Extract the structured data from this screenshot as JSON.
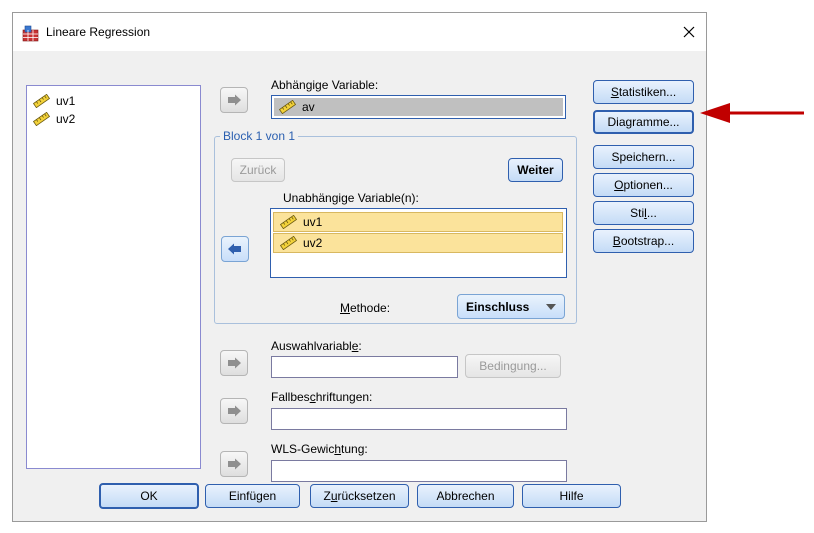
{
  "dialog": {
    "title": "Lineare Regression",
    "close_glyph": "✕"
  },
  "source_list": {
    "items": [
      {
        "label": "uv1",
        "icon": "ruler-icon"
      },
      {
        "label": "uv2",
        "icon": "ruler-icon"
      }
    ]
  },
  "dependent": {
    "label": "Abhängige Variable:",
    "value": "av"
  },
  "block": {
    "title": "Block 1 von 1",
    "back_label": "Zurück",
    "next_label": "Weiter",
    "independent_label_pre": "Unabhän",
    "independent_label_u": "g",
    "independent_label_post": "ige Variable(n):",
    "independent_items": [
      {
        "label": "uv1",
        "icon": "ruler-icon"
      },
      {
        "label": "uv2",
        "icon": "ruler-icon"
      }
    ],
    "method_label_u": "M",
    "method_label_post": "ethode:",
    "method_value": "Einschluss"
  },
  "selection": {
    "label_pre": "Auswahlvariabl",
    "label_u": "e",
    "label_post": ":",
    "condition_pre": "Bedin",
    "condition_u": "g",
    "condition_post": "ung..."
  },
  "case_labels": {
    "label_pre": "Fallbes",
    "label_u": "c",
    "label_post": "hriftungen:"
  },
  "wls": {
    "label_pre": "WLS-Gewic",
    "label_u": "h",
    "label_post": "tung:"
  },
  "side_buttons": {
    "statistics": {
      "u": "S",
      "rest": "tatistiken..."
    },
    "plots": {
      "pre": "",
      "label": "Diagramme..."
    },
    "save": {
      "label": "Speichern..."
    },
    "options": {
      "u": "O",
      "rest": "ptionen..."
    },
    "style": {
      "pre": "Sti",
      "u": "l",
      "post": "..."
    },
    "bootstrap": {
      "u": "B",
      "rest": "ootstrap..."
    }
  },
  "bottom_buttons": {
    "ok": "OK",
    "paste": "Einfügen",
    "reset_pre": "Z",
    "reset_u": "u",
    "reset_post": "rücksetzen",
    "cancel": "Abbrechen",
    "help": "Hilfe"
  },
  "colors": {
    "accent_blue": "#2f5fae",
    "selection_yellow": "#fbe39b",
    "annotation_red": "#c00000"
  }
}
